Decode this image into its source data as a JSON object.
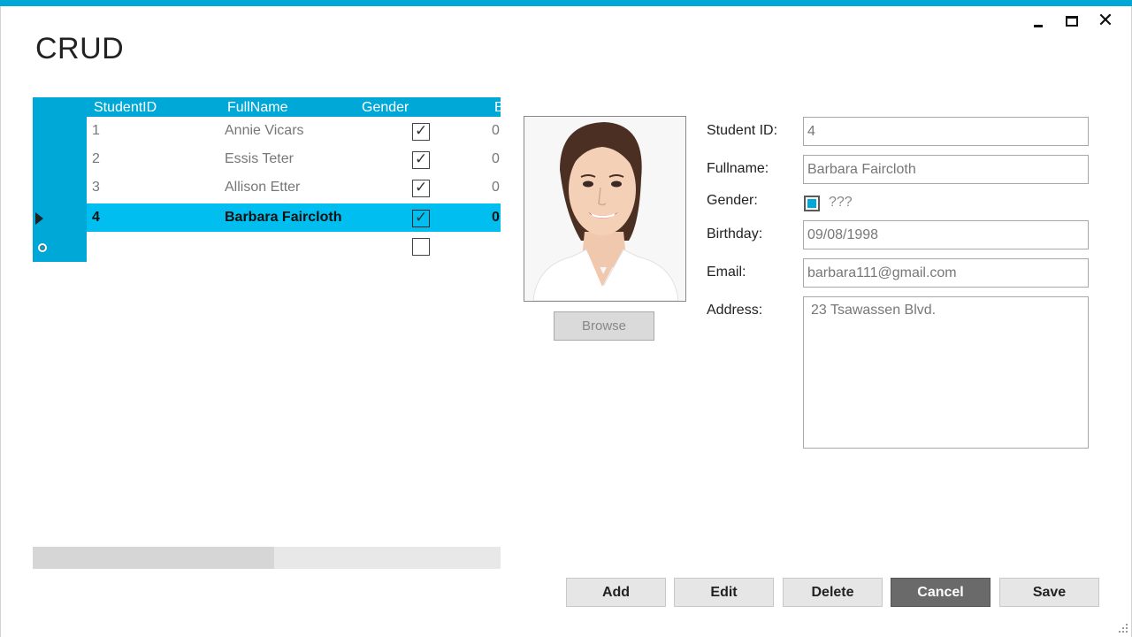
{
  "window": {
    "title": "CRUD",
    "controls": {
      "minimize": "minimize-icon",
      "maximize": "maximize-icon",
      "close": "close-icon",
      "close_glyph": "✕"
    }
  },
  "grid": {
    "columns": [
      "StudentID",
      "FullName",
      "Gender",
      "B"
    ],
    "rows": [
      {
        "id": "1",
        "name": "Annie Vicars",
        "gender_checked": true,
        "extra": "0"
      },
      {
        "id": "2",
        "name": "Essis Teter",
        "gender_checked": true,
        "extra": "0"
      },
      {
        "id": "3",
        "name": "Allison Etter",
        "gender_checked": true,
        "extra": "0"
      },
      {
        "id": "4",
        "name": "Barbara Faircloth",
        "gender_checked": true,
        "extra": "0",
        "selected": true
      }
    ],
    "new_row": {
      "gender_checked": false
    },
    "check_glyph": "✓"
  },
  "photo": {
    "browse_label": "Browse"
  },
  "form": {
    "student_id": {
      "label": "Student ID:",
      "value": "4"
    },
    "fullname": {
      "label": "Fullname:",
      "value": "Barbara Faircloth"
    },
    "gender": {
      "label": "Gender:",
      "text": "???",
      "checked": true
    },
    "birthday": {
      "label": "Birthday:",
      "value": "09/08/1998"
    },
    "email": {
      "label": "Email:",
      "value": "barbara111@gmail.com"
    },
    "address": {
      "label": "Address:",
      "value": "23 Tsawassen Blvd."
    }
  },
  "actions": {
    "add": "Add",
    "edit": "Edit",
    "delete": "Delete",
    "cancel": "Cancel",
    "save": "Save"
  },
  "colors": {
    "accent": "#00a8d8",
    "selected_row": "#00bff0",
    "cancel_bg": "#6a6a6a"
  }
}
